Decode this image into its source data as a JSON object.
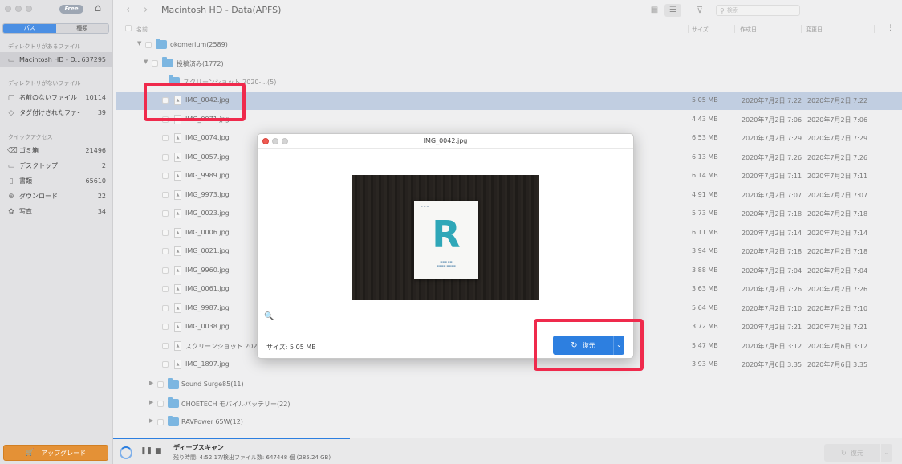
{
  "sidebar": {
    "free_badge": "Free",
    "tabs": [
      "パス",
      "種類"
    ],
    "section_dir": "ディレクトリがあるファイル",
    "drive_item": {
      "label": "Macintosh HD - D...",
      "count": "637295"
    },
    "section_nodir": "ディレクトリがないファイル",
    "nodir_items": [
      {
        "icon": "folder-icon",
        "label": "名前のないファイル",
        "count": "10114"
      },
      {
        "icon": "tag-icon",
        "label": "タグ付けされたファイル",
        "count": "39"
      }
    ],
    "section_quick": "クイックアクセス",
    "quick_items": [
      {
        "icon": "trash-icon",
        "label": "ゴミ箱",
        "count": "21496"
      },
      {
        "icon": "desktop-icon",
        "label": "デスクトップ",
        "count": "2"
      },
      {
        "icon": "document-icon",
        "label": "書類",
        "count": "65610"
      },
      {
        "icon": "download-icon",
        "label": "ダウンロード",
        "count": "22"
      },
      {
        "icon": "photo-icon",
        "label": "写真",
        "count": "34"
      }
    ],
    "upgrade_label": "アップグレード"
  },
  "toolbar": {
    "title": "Macintosh HD - Data(APFS)",
    "search_placeholder": "検索"
  },
  "columns": {
    "name": "名前",
    "size": "サイズ",
    "created": "作成日",
    "modified": "変更日"
  },
  "tree": {
    "root": "okomerium(2589)",
    "sub": "投稿済み(1772)",
    "hidden_folder": "スクリーンショット 2020-...(5)"
  },
  "files": [
    {
      "name": "IMG_0042.jpg",
      "size": "5.05 MB",
      "created": "2020年7月2日 7:22",
      "modified": "2020年7月2日 7:22"
    },
    {
      "name": "IMG_9971.jpg",
      "size": "4.43 MB",
      "created": "2020年7月2日 7:06",
      "modified": "2020年7月2日 7:06"
    },
    {
      "name": "IMG_0074.jpg",
      "size": "6.53 MB",
      "created": "2020年7月2日 7:29",
      "modified": "2020年7月2日 7:29"
    },
    {
      "name": "IMG_0057.jpg",
      "size": "6.13 MB",
      "created": "2020年7月2日 7:26",
      "modified": "2020年7月2日 7:26"
    },
    {
      "name": "IMG_9989.jpg",
      "size": "6.14 MB",
      "created": "2020年7月2日 7:11",
      "modified": "2020年7月2日 7:11"
    },
    {
      "name": "IMG_9973.jpg",
      "size": "4.91 MB",
      "created": "2020年7月2日 7:07",
      "modified": "2020年7月2日 7:07"
    },
    {
      "name": "IMG_0023.jpg",
      "size": "5.73 MB",
      "created": "2020年7月2日 7:18",
      "modified": "2020年7月2日 7:18"
    },
    {
      "name": "IMG_0006.jpg",
      "size": "6.11 MB",
      "created": "2020年7月2日 7:14",
      "modified": "2020年7月2日 7:14"
    },
    {
      "name": "IMG_0021.jpg",
      "size": "3.94 MB",
      "created": "2020年7月2日 7:18",
      "modified": "2020年7月2日 7:18"
    },
    {
      "name": "IMG_9960.jpg",
      "size": "3.88 MB",
      "created": "2020年7月2日 7:04",
      "modified": "2020年7月2日 7:04"
    },
    {
      "name": "IMG_0061.jpg",
      "size": "3.63 MB",
      "created": "2020年7月2日 7:26",
      "modified": "2020年7月2日 7:26"
    },
    {
      "name": "IMG_9987.jpg",
      "size": "5.64 MB",
      "created": "2020年7月2日 7:10",
      "modified": "2020年7月2日 7:10"
    },
    {
      "name": "IMG_0038.jpg",
      "size": "3.72 MB",
      "created": "2020年7月2日 7:21",
      "modified": "2020年7月2日 7:21"
    },
    {
      "name": "スクリーンショット 2020-0",
      "size": "5.47 MB",
      "created": "2020年7月6日 3:12",
      "modified": "2020年7月6日 3:12"
    },
    {
      "name": "IMG_1897.jpg",
      "size": "3.93 MB",
      "created": "2020年7月6日 3:35",
      "modified": "2020年7月6日 3:35"
    }
  ],
  "folders": [
    {
      "name": "Sound Surge85(11)"
    },
    {
      "name": "CHOETECH モバイルバッテリー(22)"
    },
    {
      "name": "RAVPower 65W(12)"
    }
  ],
  "dialog": {
    "title": "IMG_0042.jpg",
    "size_label": "サイズ: 5.05 MB",
    "restore_label": "復元",
    "photo_logo": "R"
  },
  "status": {
    "title": "ディープスキャン",
    "detail": "残り時間: 4:52:17/検出ファイル数: 647448 個 (285.24 GB)",
    "restore_label": "復元",
    "scan_progress": 0.3
  },
  "colors": {
    "accent": "#2d7fe0",
    "highlight": "#ef2a4c",
    "upgrade": "#e49136",
    "folder": "#4a9ad6"
  }
}
